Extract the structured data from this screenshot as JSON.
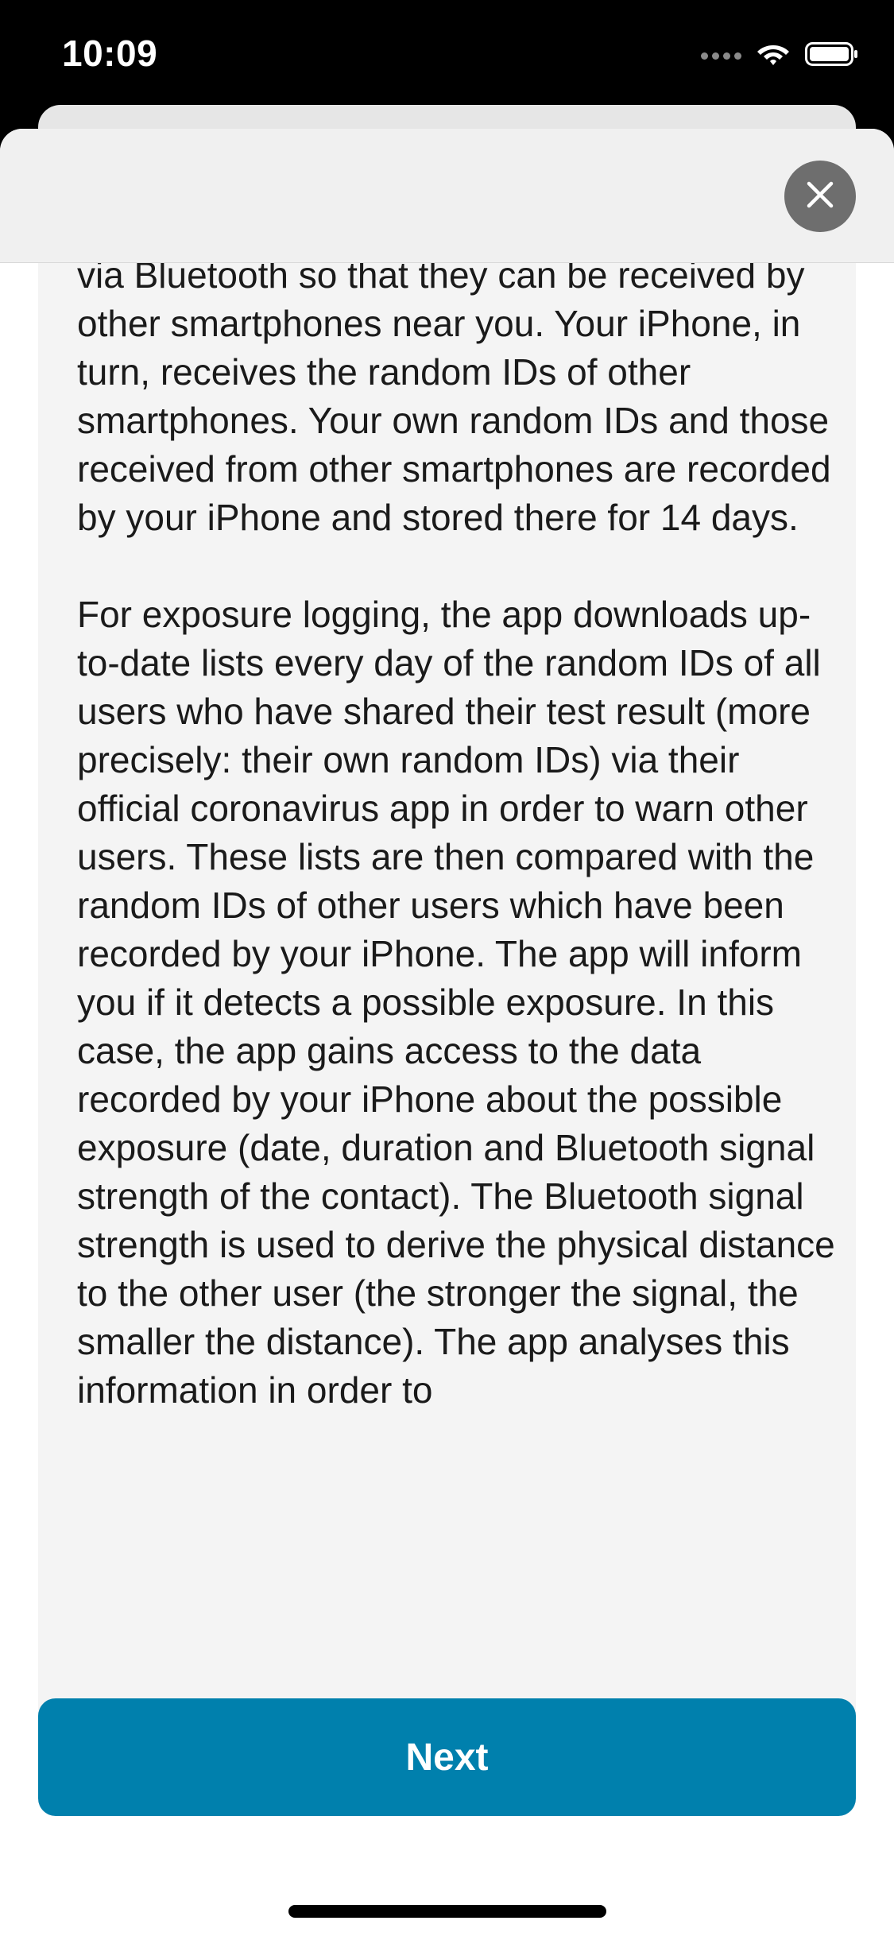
{
  "status_bar": {
    "time": "10:09"
  },
  "icons": {
    "close": "close-icon",
    "wifi": "wifi-icon",
    "battery": "battery-icon",
    "signal": "signal-icon"
  },
  "content": {
    "paragraphs": [
      "via Bluetooth so that they can be received by other smartphones near you. Your iPhone, in turn, receives the random IDs of other smartphones. Your own random IDs and those received from other smartphones are recorded by your iPhone and stored there for 14 days.",
      "For exposure logging, the app downloads up-to-date lists every day of the random IDs of all users who have shared their test result (more precisely: their own random IDs) via their official coronavirus app in order to warn other users. These lists are then compared with the random IDs of other users which have been recorded by your iPhone. The app will inform you if it detects a possible exposure. In this case, the app gains access to the data recorded by your iPhone about the possible exposure (date, duration and Bluetooth signal strength of the contact). The Bluetooth signal strength is used to derive the physical distance to the other user (the stronger the signal, the smaller the distance). The app analyses this information in order to"
    ]
  },
  "footer": {
    "next_label": "Next"
  },
  "colors": {
    "primary_button": "#0080ad",
    "content_background": "#f4f4f4",
    "close_button": "#6e6e6e"
  }
}
